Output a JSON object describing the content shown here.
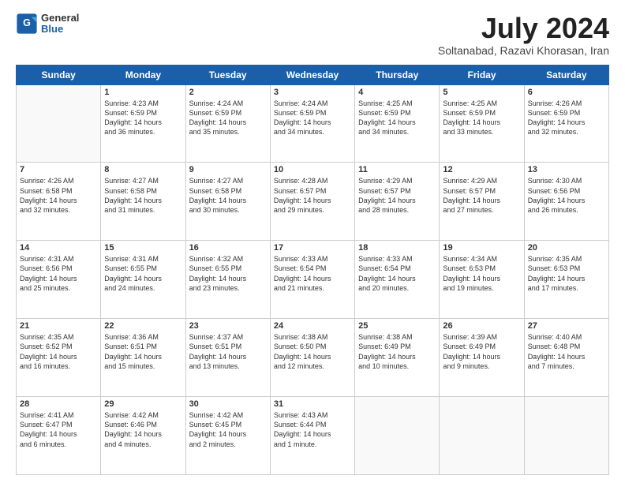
{
  "header": {
    "logo_general": "General",
    "logo_blue": "Blue",
    "month_year": "July 2024",
    "location": "Soltanabad, Razavi Khorasan, Iran"
  },
  "weekdays": [
    "Sunday",
    "Monday",
    "Tuesday",
    "Wednesday",
    "Thursday",
    "Friday",
    "Saturday"
  ],
  "weeks": [
    [
      null,
      {
        "day": 1,
        "sunrise": "4:23 AM",
        "sunset": "6:59 PM",
        "daylight": "14 hours and 36 minutes."
      },
      {
        "day": 2,
        "sunrise": "4:24 AM",
        "sunset": "6:59 PM",
        "daylight": "14 hours and 35 minutes."
      },
      {
        "day": 3,
        "sunrise": "4:24 AM",
        "sunset": "6:59 PM",
        "daylight": "14 hours and 34 minutes."
      },
      {
        "day": 4,
        "sunrise": "4:25 AM",
        "sunset": "6:59 PM",
        "daylight": "14 hours and 34 minutes."
      },
      {
        "day": 5,
        "sunrise": "4:25 AM",
        "sunset": "6:59 PM",
        "daylight": "14 hours and 33 minutes."
      },
      {
        "day": 6,
        "sunrise": "4:26 AM",
        "sunset": "6:59 PM",
        "daylight": "14 hours and 32 minutes."
      }
    ],
    [
      {
        "day": 7,
        "sunrise": "4:26 AM",
        "sunset": "6:58 PM",
        "daylight": "14 hours and 32 minutes."
      },
      {
        "day": 8,
        "sunrise": "4:27 AM",
        "sunset": "6:58 PM",
        "daylight": "14 hours and 31 minutes."
      },
      {
        "day": 9,
        "sunrise": "4:27 AM",
        "sunset": "6:58 PM",
        "daylight": "14 hours and 30 minutes."
      },
      {
        "day": 10,
        "sunrise": "4:28 AM",
        "sunset": "6:57 PM",
        "daylight": "14 hours and 29 minutes."
      },
      {
        "day": 11,
        "sunrise": "4:29 AM",
        "sunset": "6:57 PM",
        "daylight": "14 hours and 28 minutes."
      },
      {
        "day": 12,
        "sunrise": "4:29 AM",
        "sunset": "6:57 PM",
        "daylight": "14 hours and 27 minutes."
      },
      {
        "day": 13,
        "sunrise": "4:30 AM",
        "sunset": "6:56 PM",
        "daylight": "14 hours and 26 minutes."
      }
    ],
    [
      {
        "day": 14,
        "sunrise": "4:31 AM",
        "sunset": "6:56 PM",
        "daylight": "14 hours and 25 minutes."
      },
      {
        "day": 15,
        "sunrise": "4:31 AM",
        "sunset": "6:55 PM",
        "daylight": "14 hours and 24 minutes."
      },
      {
        "day": 16,
        "sunrise": "4:32 AM",
        "sunset": "6:55 PM",
        "daylight": "14 hours and 23 minutes."
      },
      {
        "day": 17,
        "sunrise": "4:33 AM",
        "sunset": "6:54 PM",
        "daylight": "14 hours and 21 minutes."
      },
      {
        "day": 18,
        "sunrise": "4:33 AM",
        "sunset": "6:54 PM",
        "daylight": "14 hours and 20 minutes."
      },
      {
        "day": 19,
        "sunrise": "4:34 AM",
        "sunset": "6:53 PM",
        "daylight": "14 hours and 19 minutes."
      },
      {
        "day": 20,
        "sunrise": "4:35 AM",
        "sunset": "6:53 PM",
        "daylight": "14 hours and 17 minutes."
      }
    ],
    [
      {
        "day": 21,
        "sunrise": "4:35 AM",
        "sunset": "6:52 PM",
        "daylight": "14 hours and 16 minutes."
      },
      {
        "day": 22,
        "sunrise": "4:36 AM",
        "sunset": "6:51 PM",
        "daylight": "14 hours and 15 minutes."
      },
      {
        "day": 23,
        "sunrise": "4:37 AM",
        "sunset": "6:51 PM",
        "daylight": "14 hours and 13 minutes."
      },
      {
        "day": 24,
        "sunrise": "4:38 AM",
        "sunset": "6:50 PM",
        "daylight": "14 hours and 12 minutes."
      },
      {
        "day": 25,
        "sunrise": "4:38 AM",
        "sunset": "6:49 PM",
        "daylight": "14 hours and 10 minutes."
      },
      {
        "day": 26,
        "sunrise": "4:39 AM",
        "sunset": "6:49 PM",
        "daylight": "14 hours and 9 minutes."
      },
      {
        "day": 27,
        "sunrise": "4:40 AM",
        "sunset": "6:48 PM",
        "daylight": "14 hours and 7 minutes."
      }
    ],
    [
      {
        "day": 28,
        "sunrise": "4:41 AM",
        "sunset": "6:47 PM",
        "daylight": "14 hours and 6 minutes."
      },
      {
        "day": 29,
        "sunrise": "4:42 AM",
        "sunset": "6:46 PM",
        "daylight": "14 hours and 4 minutes."
      },
      {
        "day": 30,
        "sunrise": "4:42 AM",
        "sunset": "6:45 PM",
        "daylight": "14 hours and 2 minutes."
      },
      {
        "day": 31,
        "sunrise": "4:43 AM",
        "sunset": "6:44 PM",
        "daylight": "14 hours and 1 minute."
      },
      null,
      null,
      null
    ]
  ]
}
